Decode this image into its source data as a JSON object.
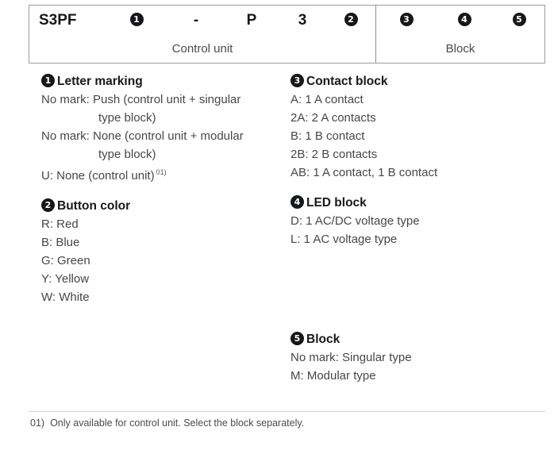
{
  "model_code": {
    "segments": [
      {
        "text": "S3PF",
        "type": "text"
      },
      {
        "text": "1",
        "type": "marker"
      },
      {
        "text": "-",
        "type": "text"
      },
      {
        "text": "P",
        "type": "text"
      },
      {
        "text": "3",
        "type": "text"
      },
      {
        "text": "2",
        "type": "marker"
      },
      {
        "text": "3",
        "type": "marker"
      },
      {
        "text": "4",
        "type": "marker"
      },
      {
        "text": "5",
        "type": "marker"
      }
    ],
    "group_control_label": "Control unit",
    "group_block_label": "Block"
  },
  "sections": {
    "letter_marking": {
      "number": "1",
      "title": "Letter marking",
      "entries": [
        {
          "text": "No mark: Push (control unit + singular"
        },
        {
          "text": "type block)",
          "continuation": true
        },
        {
          "text": "No mark: None (control unit + modular"
        },
        {
          "text": "type block)",
          "continuation": true
        },
        {
          "text": "U: None (control unit)",
          "footnote": "01)"
        }
      ]
    },
    "button_color": {
      "number": "2",
      "title": "Button color",
      "entries": [
        {
          "text": "R: Red"
        },
        {
          "text": "B: Blue"
        },
        {
          "text": "G: Green"
        },
        {
          "text": "Y: Yellow"
        },
        {
          "text": "W: White"
        }
      ]
    },
    "contact_block": {
      "number": "3",
      "title": "Contact block",
      "entries": [
        {
          "text": "A: 1 A contact"
        },
        {
          "text": "2A: 2 A contacts"
        },
        {
          "text": "B: 1 B contact"
        },
        {
          "text": "2B: 2 B contacts"
        },
        {
          "text": "AB: 1 A contact, 1 B contact"
        }
      ]
    },
    "led_block": {
      "number": "4",
      "title": "LED block",
      "entries": [
        {
          "text": "D: 1 AC/DC voltage type"
        },
        {
          "text": "L: 1 AC voltage type"
        }
      ]
    },
    "block": {
      "number": "5",
      "title": "Block",
      "entries": [
        {
          "text": "No mark: Singular type"
        },
        {
          "text": "M: Modular type"
        }
      ]
    }
  },
  "footnote": {
    "number": "01)",
    "text": "Only available for control unit. Select the block separately."
  },
  "colors": {
    "marker_bg": "#161719",
    "heading": "#17181a",
    "body": "#464749",
    "border": "#9b9b9b"
  }
}
